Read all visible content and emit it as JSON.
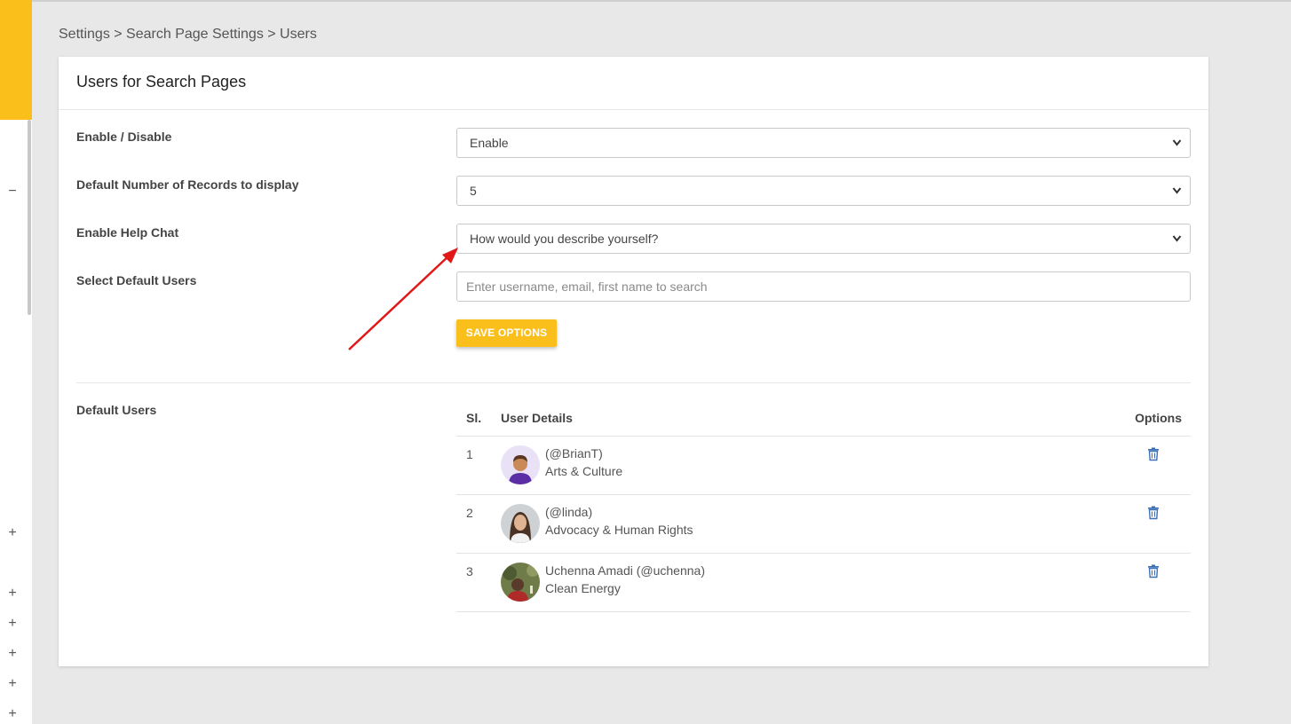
{
  "breadcrumb": "Settings > Search Page Settings > Users",
  "card": {
    "title": "Users for Search Pages"
  },
  "form": {
    "enable_label": "Enable / Disable",
    "enable_value": "Enable",
    "records_label": "Default Number of Records to display",
    "records_value": "5",
    "chat_label": "Enable Help Chat",
    "chat_value": "How would you describe yourself?",
    "users_label": "Select Default Users",
    "users_placeholder": "Enter username, email, first name to search",
    "save_label": "SAVE OPTIONS"
  },
  "default_users": {
    "label": "Default Users",
    "headers": {
      "sl": "Sl.",
      "details": "User Details",
      "options": "Options"
    },
    "rows": [
      {
        "sl": "1",
        "handle": "(@BrianT)",
        "category": "Arts & Culture",
        "avatar": "cartoon-avatar"
      },
      {
        "sl": "2",
        "handle": "(@linda)",
        "category": "Advocacy & Human Rights",
        "avatar": "photo-avatar"
      },
      {
        "sl": "3",
        "handle": "Uchenna Amadi (@uchenna)",
        "category": "Clean Energy",
        "avatar": "photo-avatar"
      }
    ]
  },
  "sidebar": {
    "glyphs": [
      "−",
      "+",
      "+",
      "+",
      "+",
      "+",
      "+"
    ]
  },
  "colors": {
    "accent": "#fbbf1c",
    "annotation_arrow": "#e01818",
    "trash_icon": "#3b6fb6"
  }
}
